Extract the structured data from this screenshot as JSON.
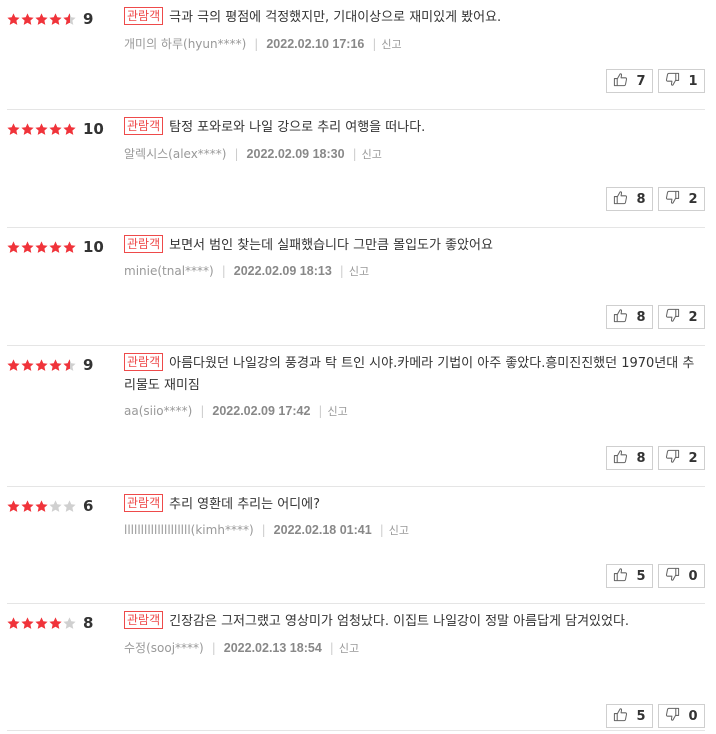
{
  "colors": {
    "star_on": "#f0333a",
    "star_off": "#d0d0d0",
    "badge": "#ee4a4a"
  },
  "reviews": [
    {
      "rating": 4.5,
      "score": "9",
      "badge": "관람객",
      "text": "극과 극의 평점에 걱정했지만, 기대이상으로 재미있게 봤어요.",
      "author": "개미의 하루(hyun****)",
      "date": "2022.02.10 17:16",
      "report": "신고",
      "likes": "7",
      "dislikes": "1"
    },
    {
      "rating": 5,
      "score": "10",
      "badge": "관람객",
      "text": "탐정 포와로와 나일 강으로 추리 여행을 떠나다.",
      "author": "알렉시스(alex****)",
      "date": "2022.02.09 18:30",
      "report": "신고",
      "likes": "8",
      "dislikes": "2"
    },
    {
      "rating": 5,
      "score": "10",
      "badge": "관람객",
      "text": "보면서 범인 찾는데 실패했습니다 그만큼 몰입도가 좋았어요",
      "author": "minie(tnal****)",
      "date": "2022.02.09 18:13",
      "report": "신고",
      "likes": "8",
      "dislikes": "2"
    },
    {
      "rating": 4.5,
      "score": "9",
      "badge": "관람객",
      "text": "아름다웠던 나일강의 풍경과 탁 트인 시야.카메라 기법이 아주 좋았다.흥미진진했던 1970년대 추리물도 재미짐",
      "author": "aa(siio****)",
      "date": "2022.02.09 17:42",
      "report": "신고",
      "likes": "8",
      "dislikes": "2"
    },
    {
      "rating": 3,
      "score": "6",
      "badge": "관람객",
      "text": "추리 영환데 추리는 어디에?",
      "author": "llllllllllllllllllll(kimh****)",
      "date": "2022.02.18 01:41",
      "report": "신고",
      "likes": "5",
      "dislikes": "0"
    },
    {
      "rating": 4,
      "score": "8",
      "badge": "관람객",
      "text": "긴장감은 그저그랬고 영상미가 엄청났다. 이집트 나일강이 정말 아름답게 담겨있었다.",
      "author": "수정(sooj****)",
      "date": "2022.02.13 18:54",
      "report": "신고",
      "likes": "5",
      "dislikes": "0"
    }
  ]
}
